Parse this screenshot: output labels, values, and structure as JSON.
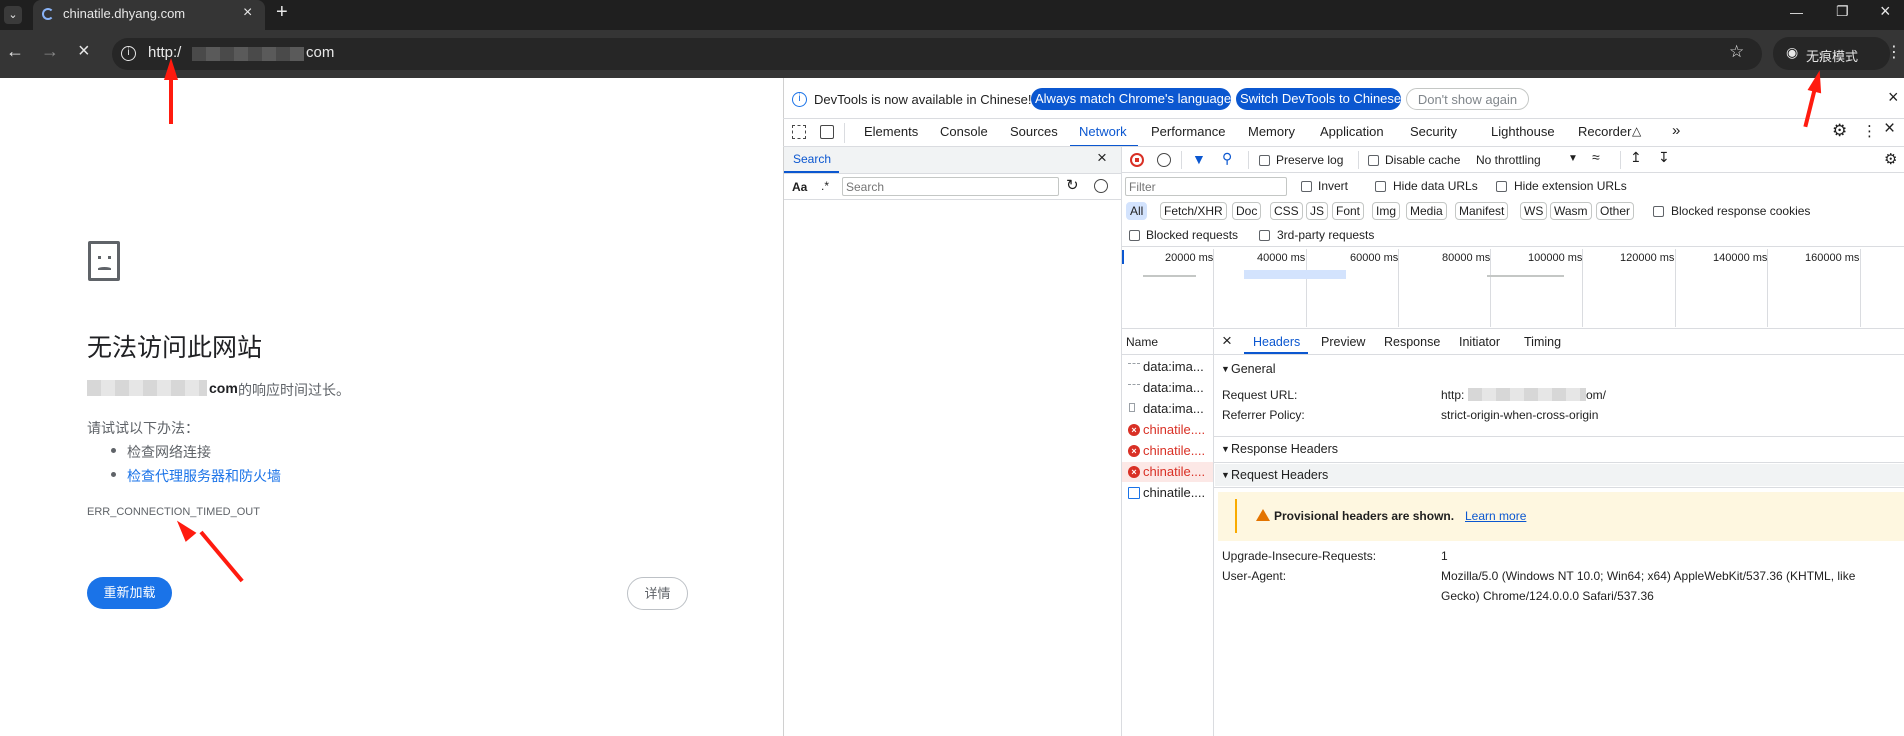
{
  "browser": {
    "tab_title": "chinatile.dhyang.com",
    "new_tab_label": "+",
    "url_prefix": "http:/",
    "url_suffix": "com",
    "incognito_label": "无痕模式",
    "window_controls": [
      "minimize-icon",
      "restore-icon",
      "close-icon"
    ]
  },
  "error_page": {
    "title": "无法访问此网站",
    "host_suffix": "com",
    "message_tail": " 的响应时间过长。",
    "try_label": "请试试以下办法：",
    "suggestions": [
      "检查网络连接",
      "检查代理服务器和防火墙"
    ],
    "error_code": "ERR_CONNECTION_TIMED_OUT",
    "reload_label": "重新加载",
    "details_label": "详情"
  },
  "devtools": {
    "infobar": {
      "text": "DevTools is now available in Chinese!",
      "match_btn": "Always match Chrome's language",
      "switch_btn": "Switch DevTools to Chinese",
      "dismiss_btn": "Don't show again"
    },
    "tabs": [
      "Elements",
      "Console",
      "Sources",
      "Network",
      "Performance",
      "Memory",
      "Application",
      "Security",
      "Lighthouse",
      "Recorder"
    ],
    "active_tab": "Network",
    "search_panel": {
      "title": "Search",
      "case_label": "Aa",
      "regex_label": ".*",
      "placeholder": "Search"
    },
    "network_toolbar": {
      "preserve_log": "Preserve log",
      "disable_cache": "Disable cache",
      "throttling": "No throttling"
    },
    "filter": {
      "placeholder": "Filter",
      "invert": "Invert",
      "hide_data_urls": "Hide data URLs",
      "hide_ext_urls": "Hide extension URLs",
      "types": [
        "All",
        "Fetch/XHR",
        "Doc",
        "CSS",
        "JS",
        "Font",
        "Img",
        "Media",
        "Manifest",
        "WS",
        "Wasm",
        "Other"
      ],
      "blocked_cookies": "Blocked response cookies",
      "blocked_requests": "Blocked requests",
      "third_party": "3rd-party requests"
    },
    "timeline_ticks": [
      "20000 ms",
      "40000 ms",
      "60000 ms",
      "80000 ms",
      "100000 ms",
      "120000 ms",
      "140000 ms",
      "160000 ms"
    ],
    "requests_header": "Name",
    "requests": [
      {
        "name": "data:ima...",
        "status": "ok"
      },
      {
        "name": "data:ima...",
        "status": "ok"
      },
      {
        "name": "data:ima...",
        "status": "ok"
      },
      {
        "name": "chinatile....",
        "status": "error"
      },
      {
        "name": "chinatile....",
        "status": "error"
      },
      {
        "name": "chinatile....",
        "status": "error"
      },
      {
        "name": "chinatile....",
        "status": "doc"
      }
    ],
    "detail_tabs": [
      "Headers",
      "Preview",
      "Response",
      "Initiator",
      "Timing"
    ],
    "active_detail_tab": "Headers",
    "general": {
      "title": "General",
      "request_url_label": "Request URL:",
      "request_url_prefix": "http:",
      "request_url_suffix": "om/",
      "referrer_label": "Referrer Policy:",
      "referrer_value": "strict-origin-when-cross-origin"
    },
    "response_headers_title": "Response Headers",
    "request_headers_title": "Request Headers",
    "provisional_warning": "Provisional headers are shown.",
    "learn_more": "Learn more",
    "request_headers": [
      {
        "name": "Upgrade-Insecure-Requests:",
        "value": "1"
      },
      {
        "name": "User-Agent:",
        "value": "Mozilla/5.0 (Windows NT 10.0; Win64; x64) AppleWebKit/537.36 (KHTML, like",
        "value2": "Gecko) Chrome/124.0.0.0 Safari/537.36"
      }
    ]
  },
  "colors": {
    "accent": "#1a73e8",
    "error": "#d93025",
    "annotation_arrow": "#ff1b0f"
  }
}
